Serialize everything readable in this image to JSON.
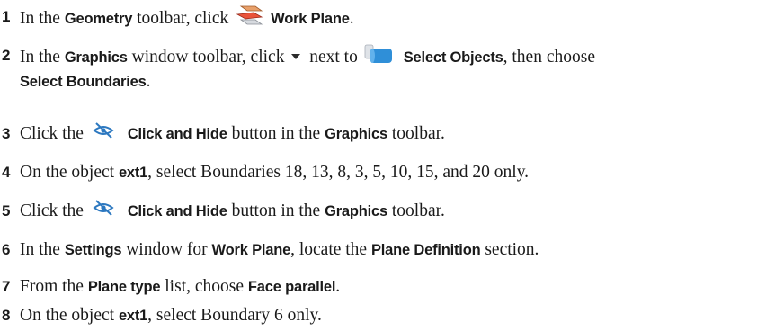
{
  "steps": [
    {
      "num": "1",
      "t1": "In the ",
      "b1": "Geometry",
      "t2": " toolbar, click ",
      "icon": "work-plane-icon",
      "b2": "Work Plane",
      "t3": "."
    },
    {
      "num": "2",
      "t1": "In the ",
      "b1": "Graphics",
      "t2": " window toolbar, click ",
      "icon1": "dropdown-arrow-icon",
      "t3": " next to ",
      "icon2": "select-objects-icon",
      "b2": "Select Objects",
      "t4": ", then choose",
      "b3": "Select Boundaries",
      "t5": "."
    },
    {
      "num": "3",
      "t1": "Click the ",
      "icon": "click-and-hide-icon",
      "b1": "Click and Hide",
      "t2": " button in the ",
      "b2": "Graphics",
      "t3": " toolbar."
    },
    {
      "num": "4",
      "t1": "On the object ",
      "b1": "ext1",
      "t2": ", select Boundaries 18, 13, 8, 3, 5, 10, 15, and 20 only."
    },
    {
      "num": "5",
      "t1": "Click the ",
      "icon": "click-and-hide-icon",
      "b1": "Click and Hide",
      "t2": " button in the ",
      "b2": "Graphics",
      "t3": " toolbar."
    },
    {
      "num": "6",
      "t1": "In the ",
      "b1": "Settings",
      "t2": " window for ",
      "b2": "Work Plane",
      "t3": ", locate the ",
      "b3": "Plane Definition",
      "t4": " section."
    },
    {
      "num": "7",
      "t1": "From the ",
      "b1": "Plane type",
      "t2": " list, choose ",
      "b2": "Face parallel",
      "t3": "."
    },
    {
      "num": "8",
      "t1": "On the object ",
      "b1": "ext1",
      "t2": ", select Boundary 6 only."
    }
  ]
}
